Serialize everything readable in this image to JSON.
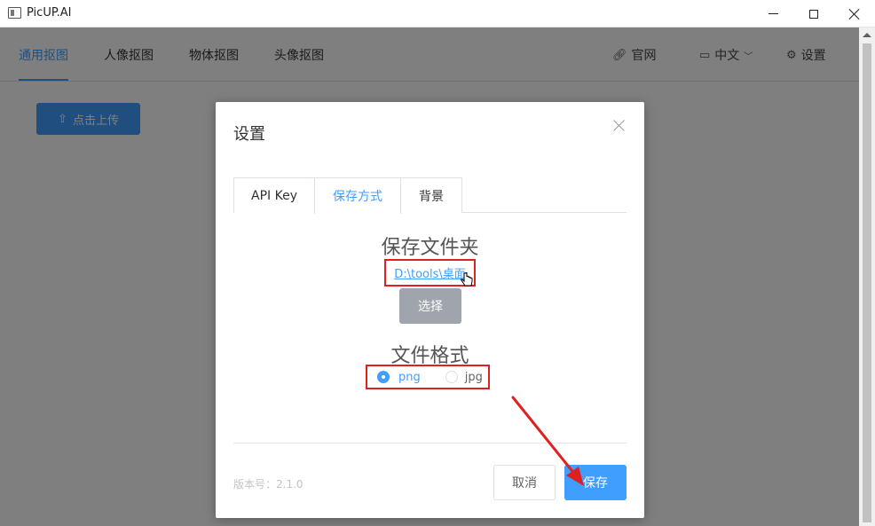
{
  "window": {
    "title": "PicUP.AI"
  },
  "nav": {
    "tabs": [
      "通用抠图",
      "人像抠图",
      "物体抠图",
      "头像抠图"
    ],
    "website": "官网",
    "language": "中文",
    "settings": "设置"
  },
  "upload": {
    "label": "点击上传"
  },
  "dialog": {
    "title": "设置",
    "tabs": [
      "API Key",
      "保存方式",
      "背景"
    ],
    "folder_title": "保存文件夹",
    "folder_path": "D:\\tools\\桌面",
    "select_label": "选择",
    "format_title": "文件格式",
    "formats": [
      "png",
      "jpg"
    ],
    "selected_format": "png",
    "version": "版本号：2.1.0",
    "cancel_label": "取消",
    "save_label": "保存"
  },
  "colors": {
    "accent": "#409eff",
    "highlight": "#e02020"
  }
}
